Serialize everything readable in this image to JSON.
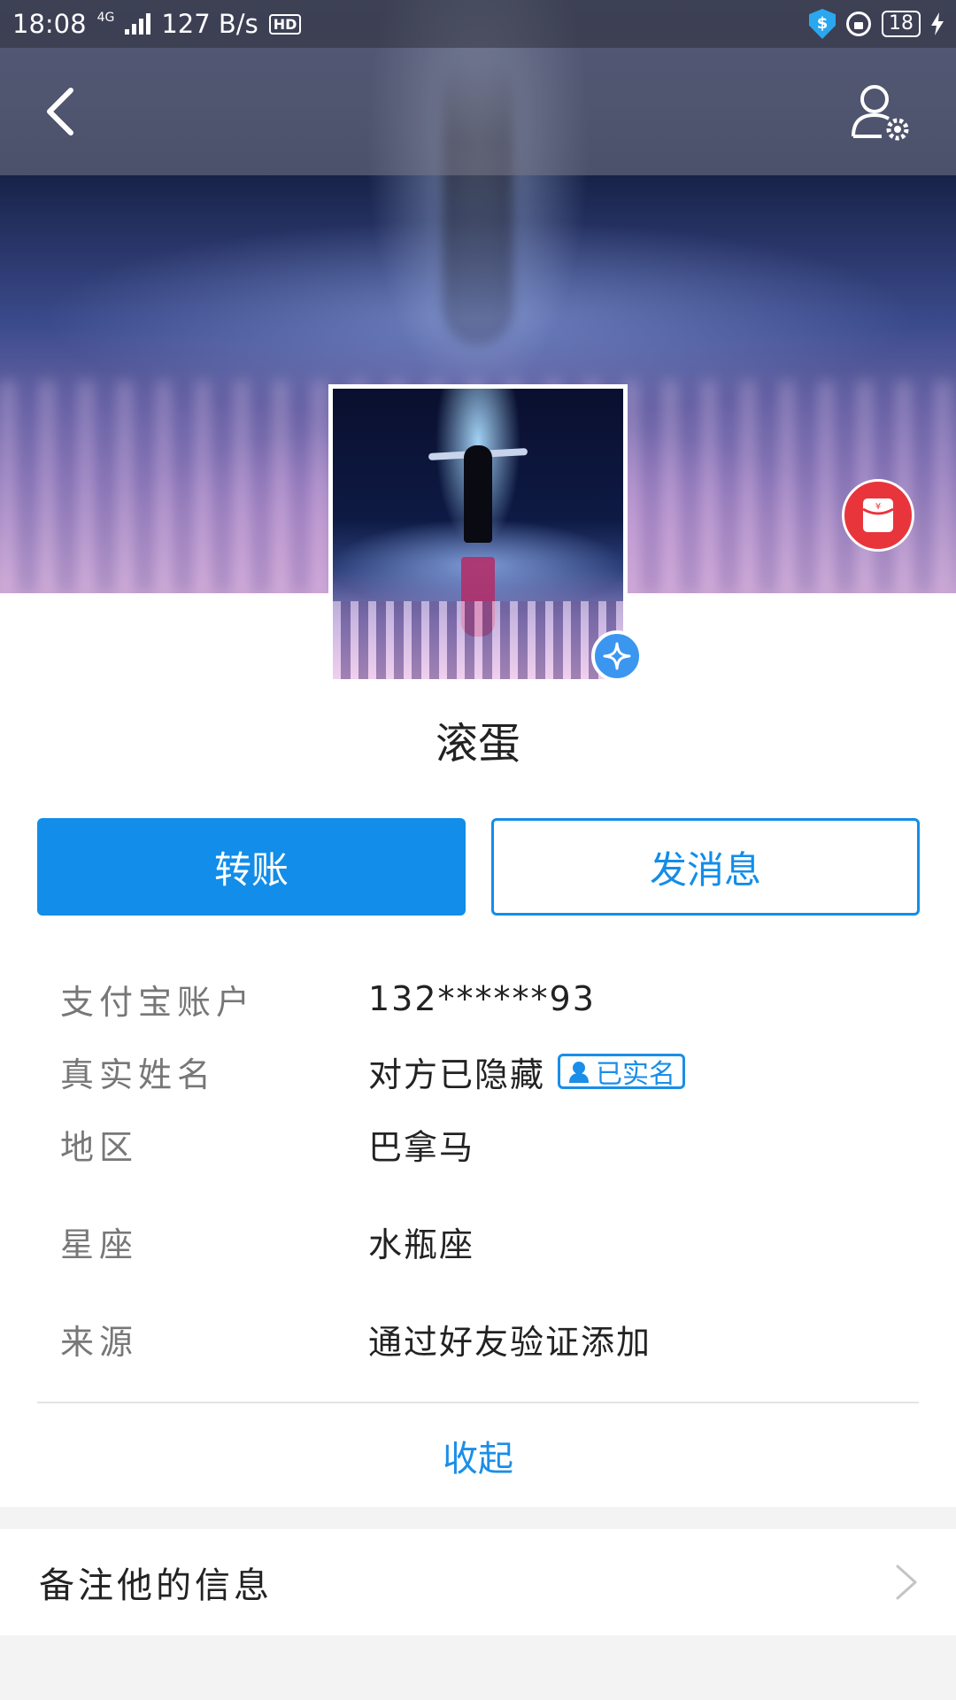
{
  "status_bar": {
    "time": "18:08",
    "network": "4G",
    "speed": "127 B/s",
    "hd": "HD",
    "battery": "18"
  },
  "profile": {
    "nickname": "滚蛋"
  },
  "actions": {
    "transfer_label": "转账",
    "message_label": "发消息"
  },
  "info": [
    {
      "label": "支付宝账户",
      "value": "132******93"
    },
    {
      "label": "真实姓名",
      "value": "对方已隐藏",
      "tag": "已实名"
    },
    {
      "label": "地区",
      "value": "巴拿马"
    },
    {
      "label": "星座",
      "value": "水瓶座"
    },
    {
      "label": "来源",
      "value": "通过好友验证添加"
    }
  ],
  "collapse_label": "收起",
  "remark_label": "备注他的信息",
  "icons": {
    "back": "back-arrow-icon",
    "settings": "profile-settings-icon",
    "red_packet": "red-packet-icon",
    "star": "star-badge-icon",
    "verified": "verified-user-icon",
    "chevron": "chevron-right-icon"
  },
  "colors": {
    "accent": "#128de9",
    "red_packet": "#e8353c"
  }
}
